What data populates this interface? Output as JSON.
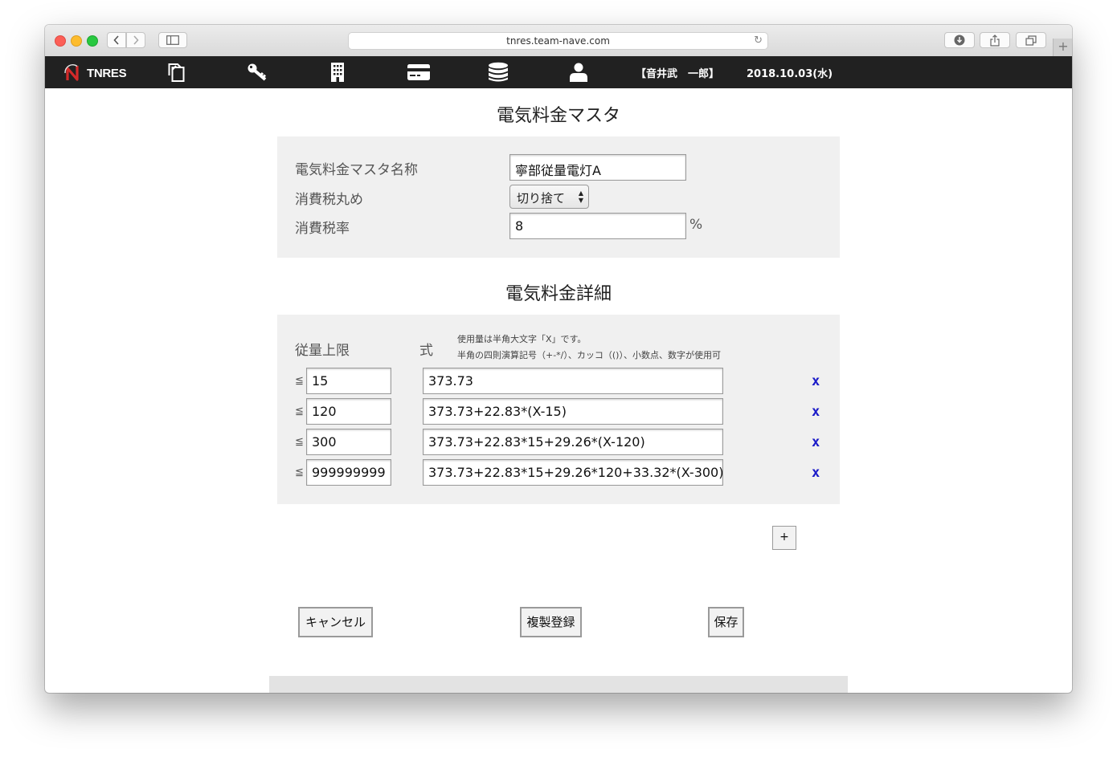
{
  "browser": {
    "url": "tnres.team-nave.com"
  },
  "nav": {
    "brand": "TNRES",
    "user": "【音井武　一郎】",
    "date": "2018.10.03(水)",
    "icons": [
      "documents-icon",
      "key-icon",
      "building-icon",
      "card-icon",
      "database-icon",
      "user-icon"
    ]
  },
  "master": {
    "title": "電気料金マスタ",
    "name_label": "電気料金マスタ名称",
    "name_value": "寧部従量電灯A",
    "rounding_label": "消費税丸め",
    "rounding_value": "切り捨て",
    "rate_label": "消費税率",
    "rate_value": "8",
    "rate_unit": "%"
  },
  "detail": {
    "title": "電気料金詳細",
    "col_limit": "従量上限",
    "col_formula": "式",
    "note_line1": "使用量は半角大文字「X」です。",
    "note_line2": "半角の四則演算記号（+-*/）、カッコ（()）、小数点、数字が使用可",
    "le_symbol": "≦",
    "delete_label": "x",
    "rows": [
      {
        "limit": "15",
        "formula": "373.73"
      },
      {
        "limit": "120",
        "formula": "373.73+22.83*(X-15)"
      },
      {
        "limit": "300",
        "formula": "373.73+22.83*15+29.26*(X-120)"
      },
      {
        "limit": "999999999",
        "formula": "373.73+22.83*15+29.26*120+33.32*(X-300)"
      }
    ],
    "add_label": "+"
  },
  "actions": {
    "cancel": "キャンセル",
    "duplicate": "複製登録",
    "save": "保存"
  }
}
